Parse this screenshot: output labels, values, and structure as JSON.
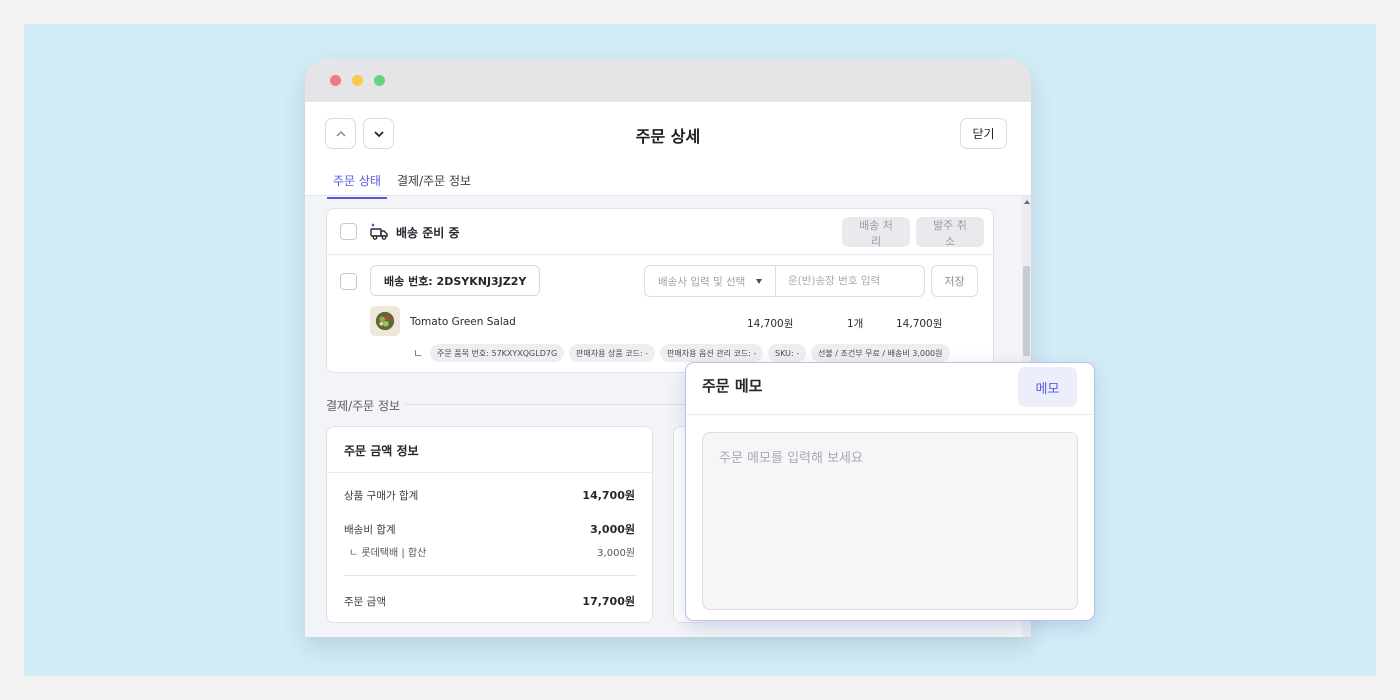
{
  "header": {
    "title": "주문 상세",
    "close_label": "닫기"
  },
  "tabs": [
    {
      "label": "주문 상태",
      "active": true
    },
    {
      "label": "결제/주문 정보",
      "active": false
    }
  ],
  "shipment": {
    "status": "배송 준비 중",
    "ship_button": "배송 처리",
    "cancel_button": "발주 취소",
    "tracking_label": "배송 번호: 2DSYKNJ3JZ2Y",
    "courier_placeholder": "배송사 입력 및 선택",
    "waybill_placeholder": "운(반)송장 번호 입력",
    "save_label": "저장",
    "product": {
      "name": "Tomato Green Salad",
      "price": "14,700원",
      "qty": "1개",
      "total": "14,700원"
    },
    "tags": [
      "주문 품목 번호: 57KXYXQGLD7G",
      "판매자용 상품 코드: -",
      "판매자용 옵션 관리 코드: -",
      "SKU: -",
      "선불 / 조건부 무료 / 배송비 3,000원"
    ],
    "sub_arrow": "ㄴ"
  },
  "payment_section": {
    "title": "결제/주문 정보"
  },
  "amount_card": {
    "title": "주문 금액 정보",
    "rows": [
      {
        "label": "상품 구매가 합계",
        "value": "14,700원"
      },
      {
        "label": "배송비 합계",
        "value": "3,000원"
      },
      {
        "label": "ㄴ 롯데택배 | 합산",
        "value": "3,000원"
      },
      {
        "label": "주문 금액",
        "value": "17,700원"
      }
    ]
  },
  "memo": {
    "title": "주문 메모",
    "button_label": "메모",
    "placeholder": "주문 메모를 입력해 보세요"
  },
  "colors": {
    "accent": "#5a58e6",
    "backdrop": "#d2edf6"
  }
}
